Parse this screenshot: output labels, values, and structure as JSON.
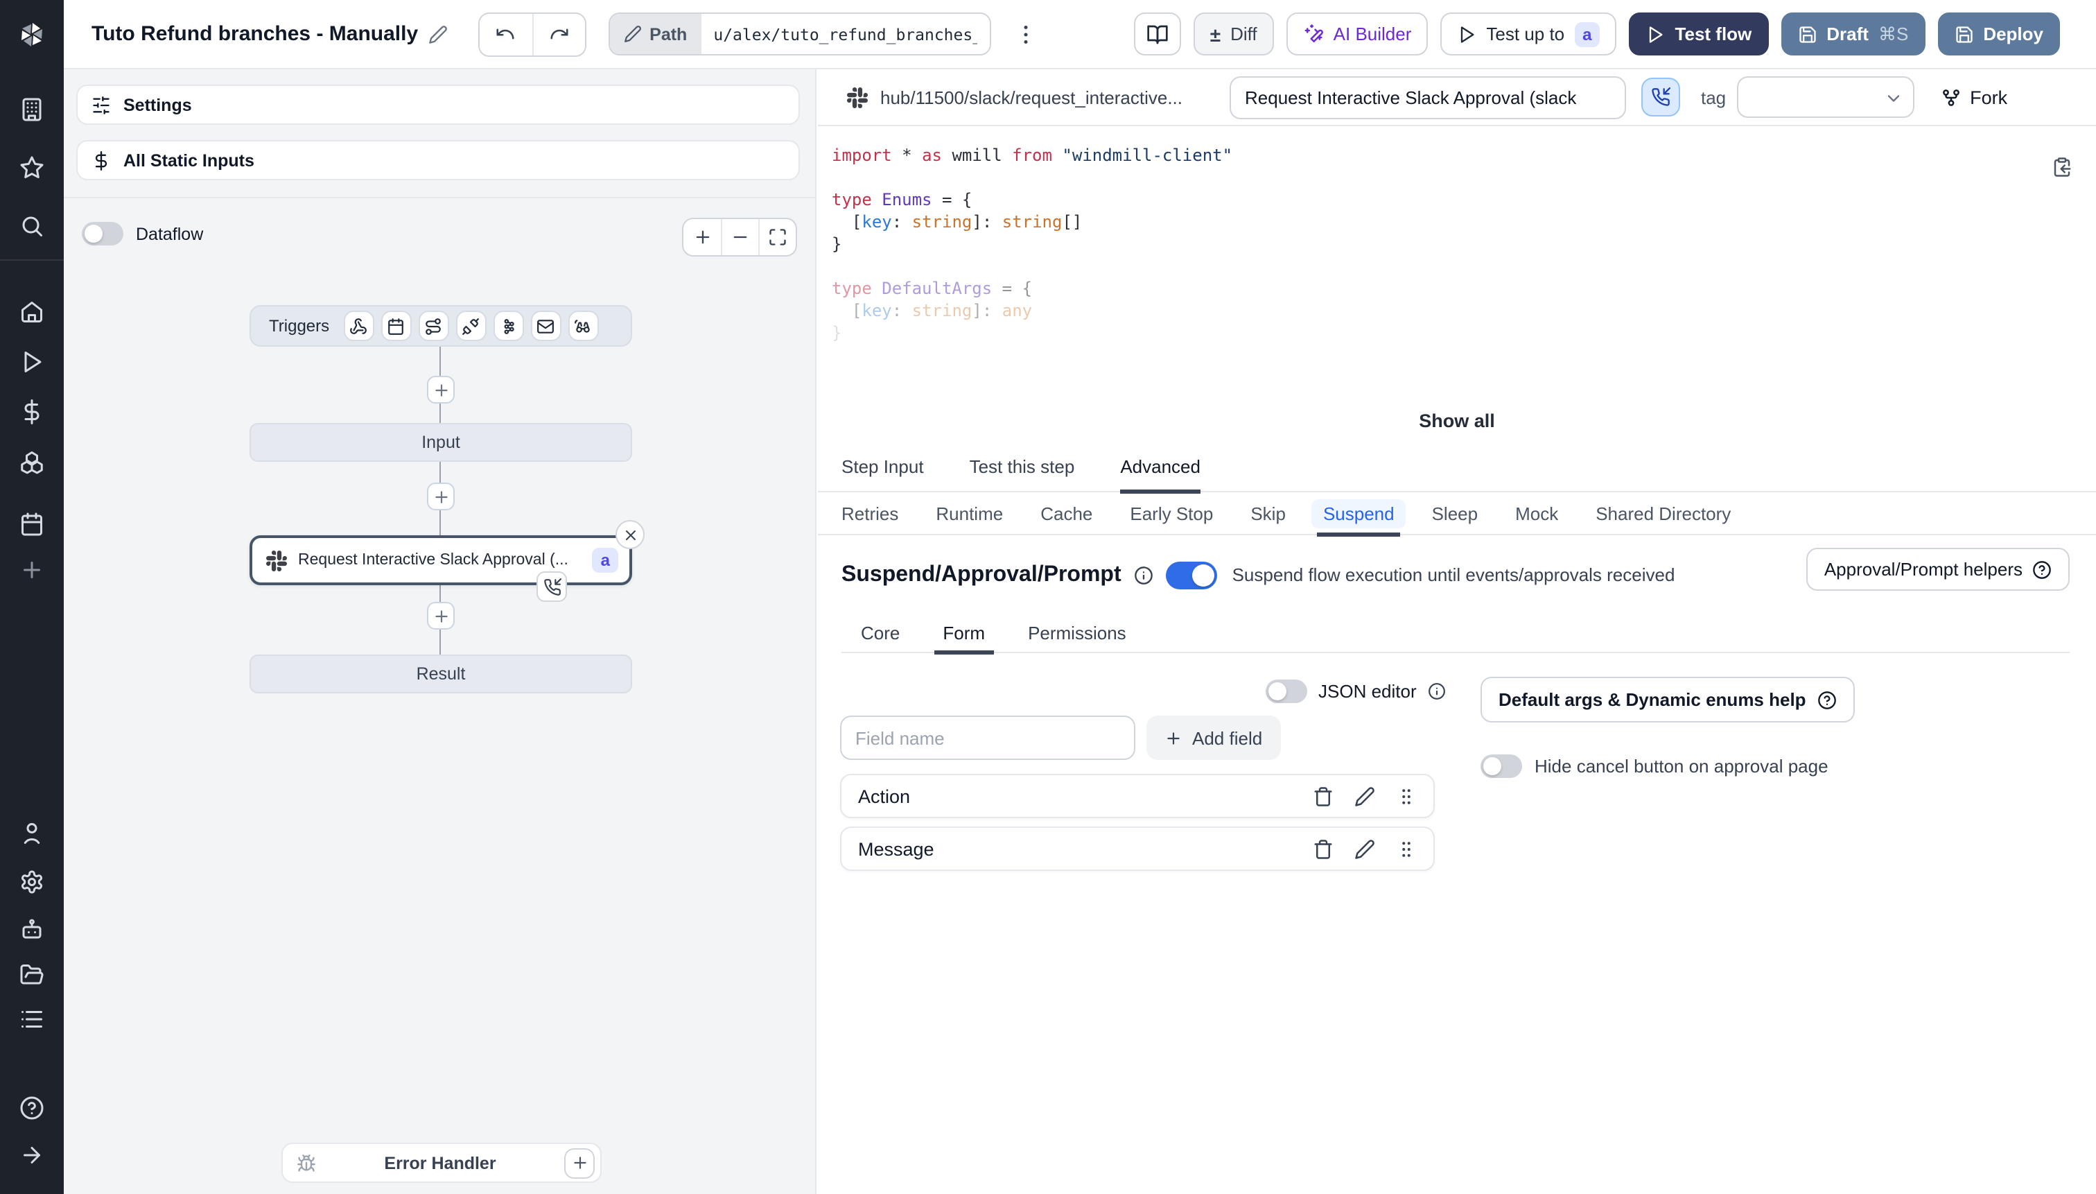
{
  "topbar": {
    "title": "Tuto Refund branches - Manually",
    "path_label": "Path",
    "path_value": "u/alex/tuto_refund_branches_",
    "diff_icon": "±",
    "diff_label": "Diff",
    "ai_builder_label": "AI Builder",
    "test_up_to_label": "Test up to",
    "test_up_to_badge": "a",
    "test_flow_label": "Test flow",
    "draft_label": "Draft",
    "draft_shortcut": "⌘S",
    "deploy_label": "Deploy"
  },
  "flow_panel": {
    "settings_label": "Settings",
    "all_static_inputs_label": "All Static Inputs",
    "dataflow_label": "Dataflow",
    "graph": {
      "triggers_label": "Triggers",
      "input_label": "Input",
      "step_label": "Request Interactive Slack Approval (...",
      "step_badge": "a",
      "result_label": "Result",
      "error_handler_label": "Error Handler"
    }
  },
  "script_header": {
    "hub_path": "hub/11500/slack/request_interactive...",
    "name_value": "Request Interactive Slack Approval (slack",
    "tag_label": "tag",
    "fork_label": "Fork"
  },
  "code": {
    "show_all_label": "Show all",
    "lines": [
      {
        "op": 1,
        "toks": [
          [
            "kw",
            "import"
          ],
          [
            "pl",
            " * "
          ],
          [
            "kw",
            "as"
          ],
          [
            "pl",
            " wmill "
          ],
          [
            "kw",
            "from"
          ],
          [
            "str",
            " \"windmill-client\""
          ]
        ]
      },
      {
        "op": 1,
        "toks": []
      },
      {
        "op": 1,
        "toks": [
          [
            "kw",
            "type"
          ],
          [
            "ty",
            " Enums"
          ],
          [
            "pl",
            " = {"
          ]
        ]
      },
      {
        "op": 1,
        "toks": [
          [
            "pl",
            "  ["
          ],
          [
            "key",
            "key"
          ],
          [
            "pl",
            ": "
          ],
          [
            "btype",
            "string"
          ],
          [
            "pl",
            "]: "
          ],
          [
            "btype",
            "string"
          ],
          [
            "pl",
            "[]"
          ]
        ]
      },
      {
        "op": 1,
        "toks": [
          [
            "pl",
            "}"
          ]
        ]
      },
      {
        "op": 1,
        "toks": []
      },
      {
        "op": 0.5,
        "toks": [
          [
            "kw",
            "type"
          ],
          [
            "ty",
            " DefaultArgs"
          ],
          [
            "pl",
            " = {"
          ]
        ]
      },
      {
        "op": 0.38,
        "toks": [
          [
            "pl",
            "  ["
          ],
          [
            "key",
            "key"
          ],
          [
            "pl",
            ": "
          ],
          [
            "btype",
            "string"
          ],
          [
            "pl",
            "]: "
          ],
          [
            "btype",
            "any"
          ]
        ]
      },
      {
        "op": 0.15,
        "toks": [
          [
            "pl",
            "}"
          ]
        ]
      }
    ]
  },
  "tabs": {
    "items": [
      "Step Input",
      "Test this step",
      "Advanced"
    ],
    "active": "Advanced"
  },
  "subtabs": {
    "items": [
      "Retries",
      "Runtime",
      "Cache",
      "Early Stop",
      "Skip",
      "Suspend",
      "Sleep",
      "Mock",
      "Shared Directory"
    ],
    "active": "Suspend"
  },
  "suspend": {
    "title": "Suspend/Approval/Prompt",
    "toggle_on": true,
    "toggle_label": "Suspend flow execution until events/approvals received",
    "helpers_label": "Approval/Prompt helpers",
    "inner_tabs": {
      "items": [
        "Core",
        "Form",
        "Permissions"
      ],
      "active": "Form"
    },
    "form": {
      "json_editor_label": "JSON editor",
      "field_name_placeholder": "Field name",
      "add_field_label": "Add field",
      "default_args_help_label": "Default args & Dynamic enums help",
      "hide_cancel_label": "Hide cancel button on approval page",
      "fields": [
        {
          "name": "Action"
        },
        {
          "name": "Message"
        }
      ]
    }
  },
  "colors": {
    "accent_blue": "#2563eb",
    "toggle_on": "#2f6de8",
    "test_flow_bg": "#323a5e",
    "deploy_bg": "#5d7a9d",
    "ai_purple": "#6d28d9",
    "badge_bg": "#e0e7ff",
    "badge_text": "#4f46e5",
    "sidebar_bg": "#1e222a"
  }
}
